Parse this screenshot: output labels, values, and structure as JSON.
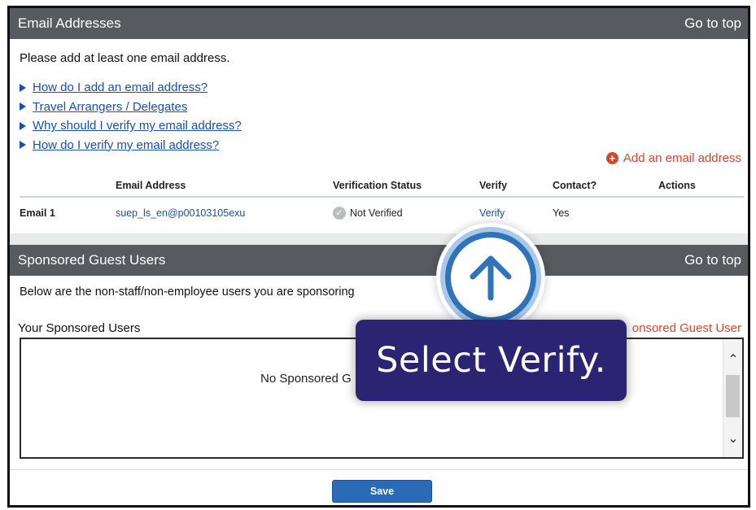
{
  "email_section": {
    "title": "Email Addresses",
    "go_to_top": "Go to top",
    "intro": "Please add at least one email address.",
    "help_links": [
      "How do I add an email address?",
      "Travel Arrangers / Delegates",
      "Why should I verify my email address?",
      "How do I verify my email address?"
    ],
    "add_email": "Add an email address",
    "table": {
      "headers": [
        "",
        "Email Address",
        "Verification Status",
        "Verify",
        "Contact?",
        "Actions"
      ],
      "rows": [
        {
          "label": "Email 1",
          "email": "suep_ls_en@p00103105exu",
          "status": "Not Verified",
          "verify": "Verify",
          "contact": "Yes"
        }
      ]
    }
  },
  "sponsored_section": {
    "title": "Sponsored Guest Users",
    "go_to_top": "Go to top",
    "intro": "Below are the non-staff/non-employee users you are sponsoring",
    "label": "Your Sponsored Users",
    "add_link": "onsored Guest User",
    "empty": "No Sponsored G"
  },
  "footer": {
    "save": "Save"
  },
  "callout": {
    "text": "Select Verify.",
    "icon": "up-arrow-icon",
    "colors": {
      "box": "#2a2472",
      "ring": "#2f73b8"
    }
  },
  "colors": {
    "header": "#575a5e",
    "link": "#1a4fae",
    "accent": "#d9452c",
    "button": "#2a6bb8"
  }
}
